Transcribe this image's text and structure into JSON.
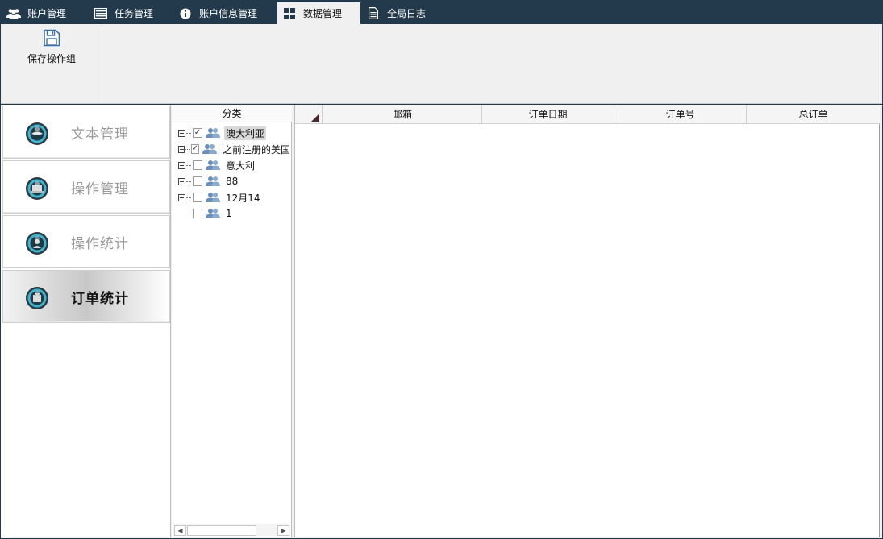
{
  "tabs": [
    {
      "label": "账户管理",
      "icon": "users-icon"
    },
    {
      "label": "任务管理",
      "icon": "list-icon"
    },
    {
      "label": "账户信息管理",
      "icon": "info-icon"
    },
    {
      "label": "数据管理",
      "icon": "grid-icon"
    },
    {
      "label": "全局日志",
      "icon": "document-icon"
    }
  ],
  "active_tab": "数据管理",
  "ribbon": {
    "save_label": "保存操作组",
    "save_icon": "floppy-disk-icon"
  },
  "nav": {
    "items": [
      {
        "label": "文本管理"
      },
      {
        "label": "操作管理"
      },
      {
        "label": "操作统计"
      },
      {
        "label": "订单统计"
      }
    ],
    "active": "订单统计"
  },
  "tree": {
    "header": "分类",
    "items": [
      {
        "label": "澳大利亚",
        "checked": true,
        "expandable": true,
        "selected": true
      },
      {
        "label": "之前注册的美国",
        "checked": true,
        "expandable": true,
        "selected": false
      },
      {
        "label": "意大利",
        "checked": false,
        "expandable": true,
        "selected": false
      },
      {
        "label": "88",
        "checked": false,
        "expandable": true,
        "selected": false
      },
      {
        "label": "12月14",
        "checked": false,
        "expandable": true,
        "selected": false
      },
      {
        "label": "1",
        "checked": false,
        "expandable": false,
        "selected": false
      }
    ]
  },
  "grid": {
    "columns": [
      "邮箱",
      "订单日期",
      "订单号",
      "总订单"
    ]
  },
  "colors": {
    "titlebar": "#233a4c",
    "panel": "#f0f0f0",
    "tree_icon": "#6a8fb8"
  }
}
